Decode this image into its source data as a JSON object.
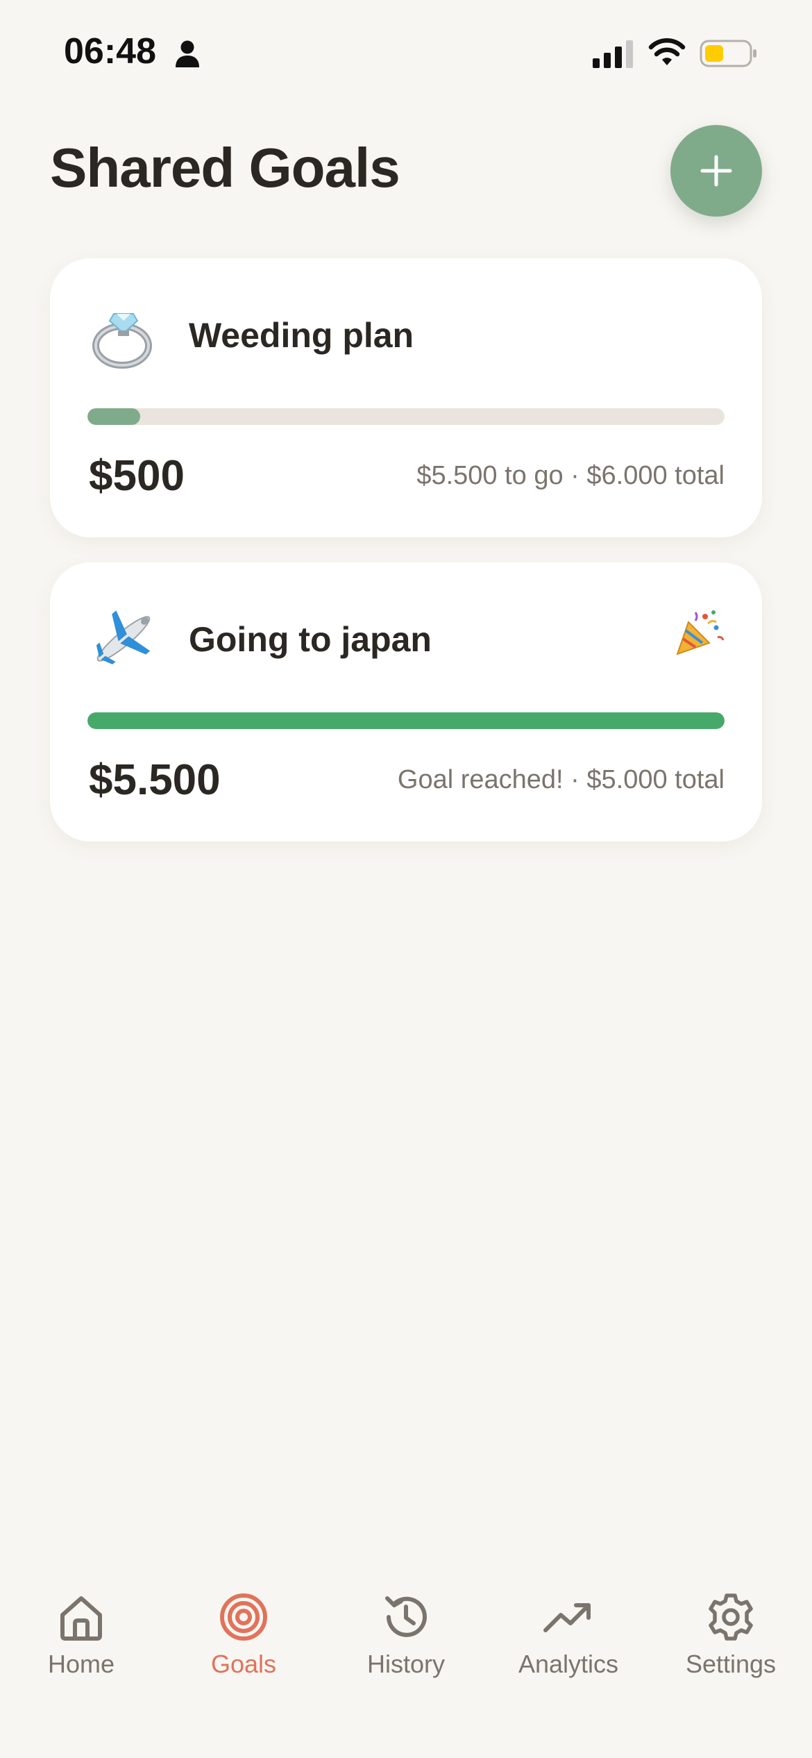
{
  "status_bar": {
    "time": "06:48",
    "icons": [
      "person-icon",
      "cellular-signal-icon",
      "wifi-icon",
      "battery-icon"
    ],
    "battery_color": "#ffcc00"
  },
  "header": {
    "title": "Shared Goals",
    "add_button_icon": "plus-icon"
  },
  "colors": {
    "accent_green": "#80ab8a",
    "goal_complete_green": "#46a96a",
    "active_tab": "#e0735b",
    "background": "#f8f6f2"
  },
  "goals": [
    {
      "name": "Weeding plan",
      "emoji": "💍",
      "amount": "$500",
      "meta": "$5.500 to go · $6.000 total",
      "progress": 0.083,
      "reached": false
    },
    {
      "name": "Going to japan",
      "emoji": "✈️",
      "amount": "$5.500",
      "meta": "Goal reached! · $5.000 total",
      "progress": 1.0,
      "reached": true,
      "badge_icon": "party-popper-icon"
    }
  ],
  "tabs": [
    {
      "label": "Home",
      "icon": "home-icon",
      "active": false
    },
    {
      "label": "Goals",
      "icon": "target-icon",
      "active": true
    },
    {
      "label": "History",
      "icon": "history-clock-icon",
      "active": false
    },
    {
      "label": "Analytics",
      "icon": "trending-up-icon",
      "active": false
    },
    {
      "label": "Settings",
      "icon": "gear-icon",
      "active": false
    }
  ]
}
